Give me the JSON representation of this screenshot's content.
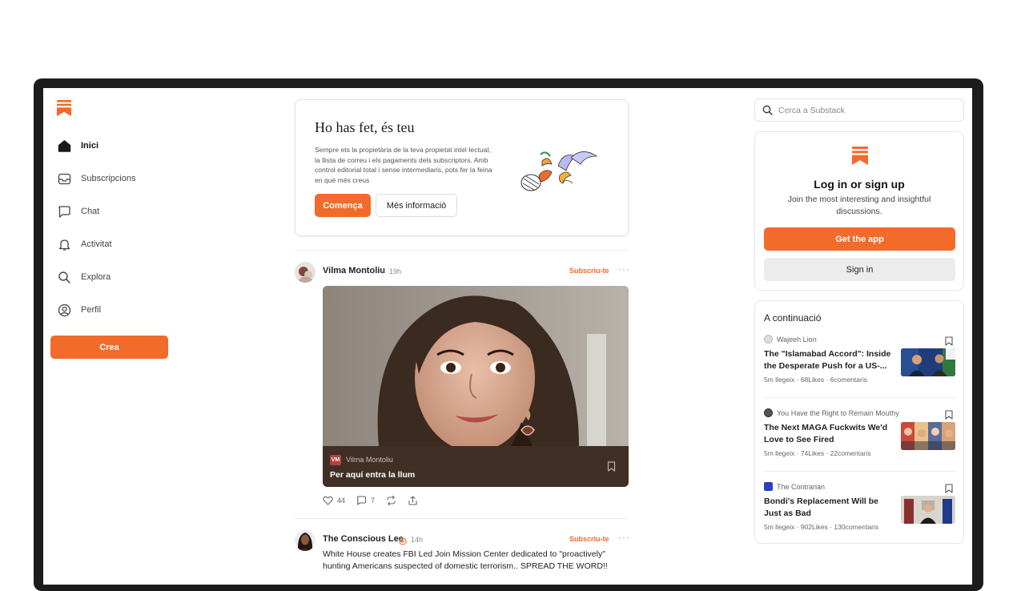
{
  "sidebar": {
    "items": [
      {
        "label": "Inici",
        "icon": "home-icon"
      },
      {
        "label": "Subscripcions",
        "icon": "inbox-icon"
      },
      {
        "label": "Chat",
        "icon": "chat-icon"
      },
      {
        "label": "Activitat",
        "icon": "bell-icon"
      },
      {
        "label": "Explora",
        "icon": "search-icon"
      },
      {
        "label": "Perfil",
        "icon": "profile-icon"
      }
    ],
    "create_label": "Crea"
  },
  "promo": {
    "title": "Ho has fet, és teu",
    "text": "Sempre ets la propietària de la teva propietat intel·lectual, la llista de correu i els pagaments dels subscriptors. Amb control editorial total i sense intermediaris, pots fer la feina en què més creus",
    "primary_label": "Comença",
    "secondary_label": "Més informació"
  },
  "post1": {
    "author": "Vilma Montoliu",
    "time": "19h",
    "subscribe_label": "Subscriu-te",
    "more_label": "···",
    "card_badge": "VM",
    "card_author": "Vilma Montoliu",
    "card_title": "Per aquí entra la llum",
    "likes": "44",
    "comments": "7"
  },
  "post2": {
    "author": "The Conscious Lee",
    "time": "14h",
    "subscribe_label": "Subscriu-te",
    "more_label": "···",
    "text": "White House creates FBI Led Join Mission Center dedicated to \"proactively\" hunting Americans suspected of domestic terrorism.. SPREAD THE WORD!!"
  },
  "search": {
    "placeholder": "Cerca a Substack"
  },
  "login": {
    "title": "Log in or sign up",
    "subtitle": "Join the most interesting and insightful discussions.",
    "app_label": "Get the app",
    "signin_label": "Sign in"
  },
  "next": {
    "title": "A continuació",
    "items": [
      {
        "publication": "Wajeeh Lion",
        "headline": "The \"Islamabad Accord\": Inside the Desperate Push for a US-...",
        "meta": "5m llegeix · 68Likes · 6comentaris"
      },
      {
        "publication": "You Have the Right to Remain Mouthy",
        "headline": "The Next MAGA Fuckwits We'd Love to See Fired",
        "meta": "5m llegeix · 74Likes · 22comentaris"
      },
      {
        "publication": "The Contrarian",
        "headline": "Bondi's Replacement Will be Just as Bad",
        "meta": "5m llegeix · 902Likes · 130comentaris"
      }
    ]
  },
  "colors": {
    "accent": "#f26b2a"
  }
}
